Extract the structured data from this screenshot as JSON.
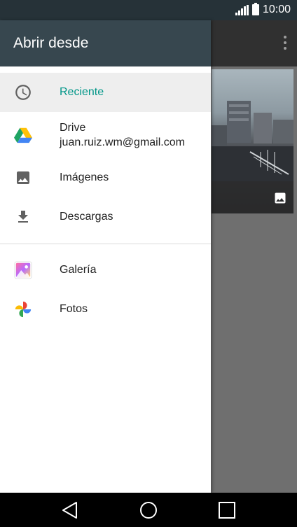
{
  "status_bar": {
    "time": "10:00"
  },
  "drawer": {
    "title": "Abrir desde",
    "items": [
      {
        "label": "Reciente",
        "icon": "clock-icon",
        "selected": true
      },
      {
        "label": "Drive",
        "sublabel": "juan.ruiz.wm@gmail.com",
        "icon": "google-drive-icon"
      },
      {
        "label": "Imágenes",
        "icon": "image-icon"
      },
      {
        "label": "Descargas",
        "icon": "download-icon"
      }
    ],
    "apps": [
      {
        "label": "Galería",
        "icon": "gallery-icon"
      },
      {
        "label": "Fotos",
        "icon": "google-photos-icon"
      }
    ]
  },
  "colors": {
    "selected": "#009688",
    "header": "#37474f",
    "statusbar": "#263238"
  }
}
